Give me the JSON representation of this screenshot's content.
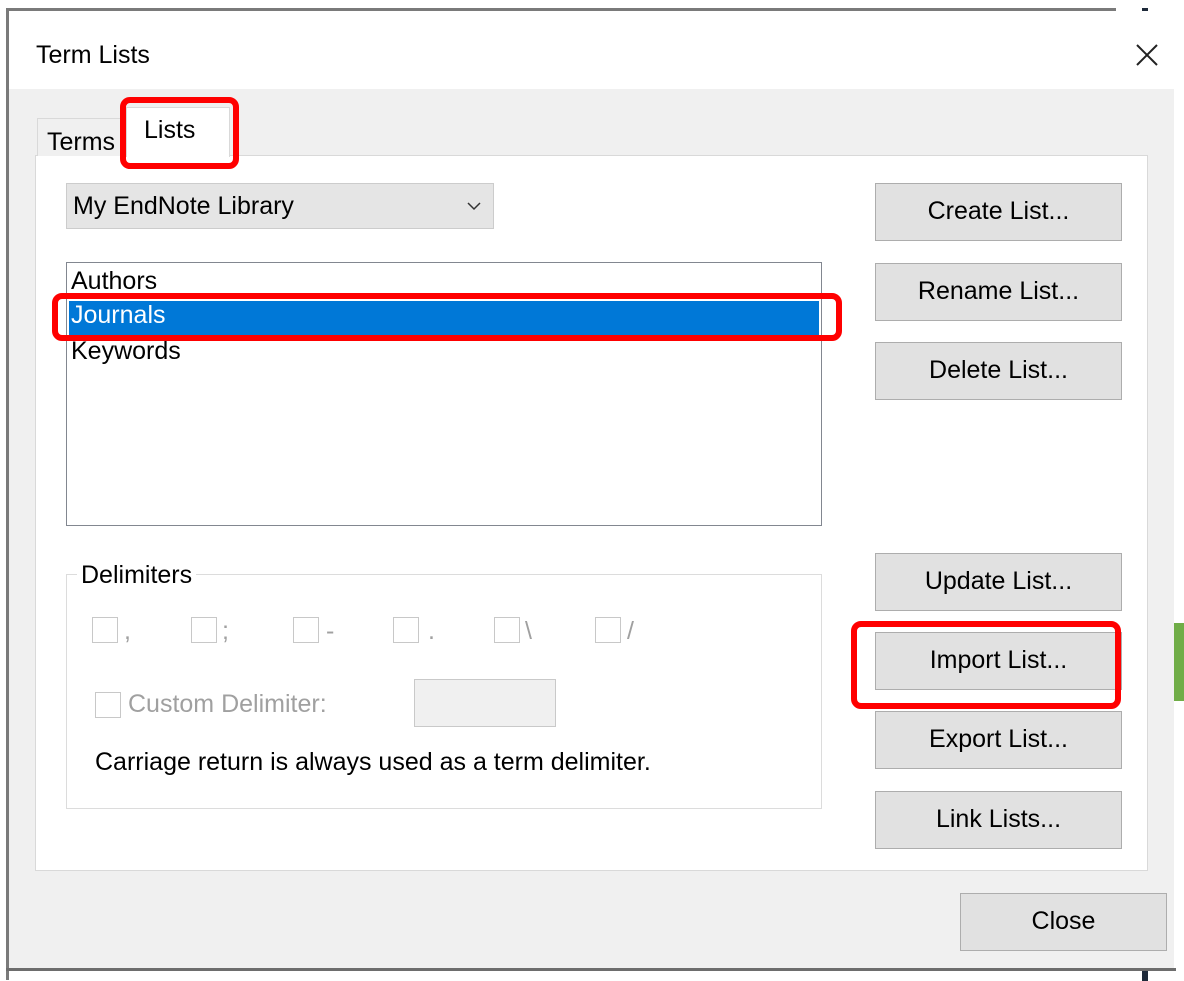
{
  "dialog": {
    "title": "Term Lists",
    "close_icon": "close-icon"
  },
  "tabs": [
    {
      "label": "Terms",
      "active": false
    },
    {
      "label": "Lists",
      "active": true
    }
  ],
  "library_select": {
    "value": "My EndNote Library",
    "icon": "chevron-down-icon"
  },
  "lists": {
    "items": [
      "Authors",
      "Journals",
      "Keywords"
    ],
    "selected": "Journals"
  },
  "buttons": {
    "create": "Create List...",
    "rename": "Rename List...",
    "delete": "Delete List...",
    "update": "Update List...",
    "import": "Import List...",
    "export": "Export List...",
    "link": "Link Lists...",
    "close": "Close"
  },
  "delimiters": {
    "title": "Delimiters",
    "options": [
      ",",
      ";",
      "-",
      ".",
      "\\",
      "/"
    ],
    "custom_label": "Custom Delimiter:",
    "custom_value": "",
    "note": "Carriage return is always used as a term delimiter."
  },
  "colors": {
    "selection": "#0078d7",
    "highlight": "#ff0000",
    "accent": "#70ad47"
  }
}
